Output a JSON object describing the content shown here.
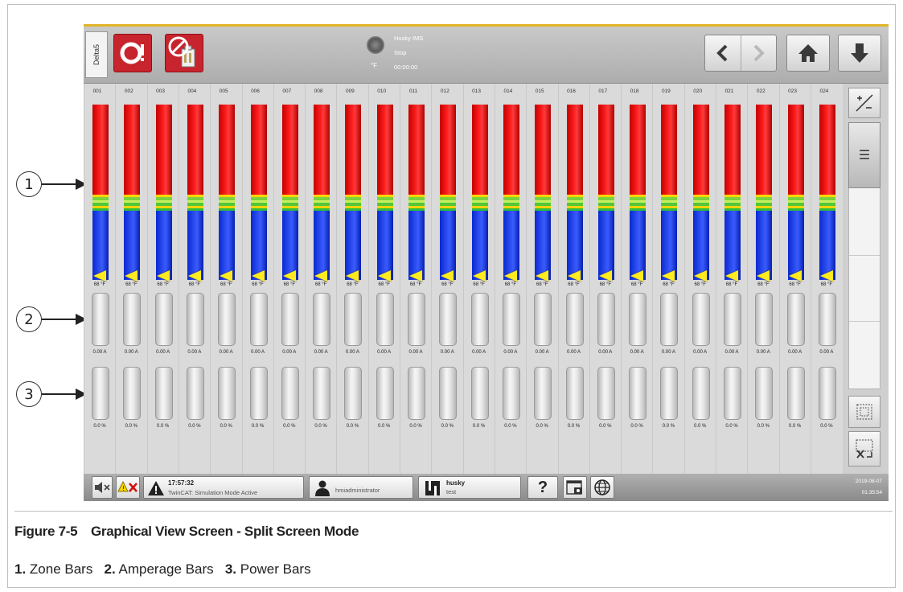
{
  "window": {
    "tab_label": "Delta5"
  },
  "status": {
    "unit": "°F",
    "system": "Husky IMS",
    "state": "Stop",
    "timer": "00:00:00"
  },
  "zones": [
    {
      "id": "001",
      "temp": "68 °F",
      "amps": "0.00 A",
      "power": "0.0 %"
    },
    {
      "id": "002",
      "temp": "68 °F",
      "amps": "0.00 A",
      "power": "0.0 %"
    },
    {
      "id": "003",
      "temp": "68 °F",
      "amps": "0.00 A",
      "power": "0.0 %"
    },
    {
      "id": "004",
      "temp": "68 °F",
      "amps": "0.00 A",
      "power": "0.0 %"
    },
    {
      "id": "005",
      "temp": "68 °F",
      "amps": "0.00 A",
      "power": "0.0 %"
    },
    {
      "id": "006",
      "temp": "68 °F",
      "amps": "0.00 A",
      "power": "0.0 %"
    },
    {
      "id": "007",
      "temp": "68 °F",
      "amps": "0.00 A",
      "power": "0.0 %"
    },
    {
      "id": "008",
      "temp": "68 °F",
      "amps": "0.00 A",
      "power": "0.0 %"
    },
    {
      "id": "009",
      "temp": "68 °F",
      "amps": "0.00 A",
      "power": "0.0 %"
    },
    {
      "id": "010",
      "temp": "68 °F",
      "amps": "0.00 A",
      "power": "0.0 %"
    },
    {
      "id": "011",
      "temp": "68 °F",
      "amps": "0.00 A",
      "power": "0.0 %"
    },
    {
      "id": "012",
      "temp": "68 °F",
      "amps": "0.00 A",
      "power": "0.0 %"
    },
    {
      "id": "013",
      "temp": "68 °F",
      "amps": "0.00 A",
      "power": "0.0 %"
    },
    {
      "id": "014",
      "temp": "68 °F",
      "amps": "0.00 A",
      "power": "0.0 %"
    },
    {
      "id": "015",
      "temp": "68 °F",
      "amps": "0.00 A",
      "power": "0.0 %"
    },
    {
      "id": "016",
      "temp": "68 °F",
      "amps": "0.00 A",
      "power": "0.0 %"
    },
    {
      "id": "017",
      "temp": "68 °F",
      "amps": "0.00 A",
      "power": "0.0 %"
    },
    {
      "id": "018",
      "temp": "68 °F",
      "amps": "0.00 A",
      "power": "0.0 %"
    },
    {
      "id": "019",
      "temp": "68 °F",
      "amps": "0.00 A",
      "power": "0.0 %"
    },
    {
      "id": "020",
      "temp": "68 °F",
      "amps": "0.00 A",
      "power": "0.0 %"
    },
    {
      "id": "021",
      "temp": "68 °F",
      "amps": "0.00 A",
      "power": "0.0 %"
    },
    {
      "id": "022",
      "temp": "68 °F",
      "amps": "0.00 A",
      "power": "0.0 %"
    },
    {
      "id": "023",
      "temp": "68 °F",
      "amps": "0.00 A",
      "power": "0.0 %"
    },
    {
      "id": "024",
      "temp": "68 °F",
      "amps": "0.00 A",
      "power": "0.0 %"
    }
  ],
  "sidebar": {
    "menu_glyph": "☰"
  },
  "footer": {
    "alarm_time": "17:57:32",
    "alarm_message": "TwinCAT: Simulation Mode Active",
    "user": "hmiadministrator",
    "mold_name": "husky",
    "mold_sub": "test",
    "help": "?",
    "date": "2019-08-07",
    "time": "01:35:54"
  },
  "callouts": [
    "1",
    "2",
    "3"
  ],
  "figure": {
    "number": "Figure 7-5",
    "title": "Graphical View Screen - Split Screen Mode",
    "legend": [
      {
        "num": "1.",
        "text": "Zone Bars"
      },
      {
        "num": "2.",
        "text": "Amperage Bars"
      },
      {
        "num": "3.",
        "text": "Power Bars"
      }
    ]
  },
  "colors": {
    "accent": "#e1b427",
    "brand_red": "#c8242d",
    "bar_hot": "#ff1e1e",
    "bar_cold": "#2e4ff2",
    "bar_band": "#7bd33a",
    "setpoint_marker": "#ffeb1f"
  }
}
